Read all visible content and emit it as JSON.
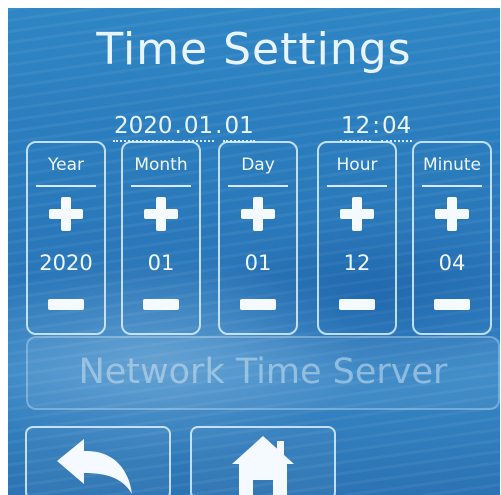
{
  "header": {
    "title": "Time Settings"
  },
  "current": {
    "year": "2020",
    "date_sep_1": ".",
    "month": "01",
    "date_sep_2": ".",
    "day": "01",
    "hour": "12",
    "time_sep": ":",
    "minute": "04"
  },
  "columns": [
    {
      "label": "Year",
      "value": "2020"
    },
    {
      "label": "Month",
      "value": "01"
    },
    {
      "label": "Day",
      "value": "01"
    },
    {
      "label": "Hour",
      "value": "12"
    },
    {
      "label": "Minute",
      "value": "04"
    }
  ],
  "network": {
    "label": "Network Time Server"
  },
  "nav": {
    "back_icon": "back-arrow-icon",
    "home_icon": "home-icon"
  },
  "colors": {
    "background": "#2a7cbd",
    "foreground": "#eef7ff"
  }
}
